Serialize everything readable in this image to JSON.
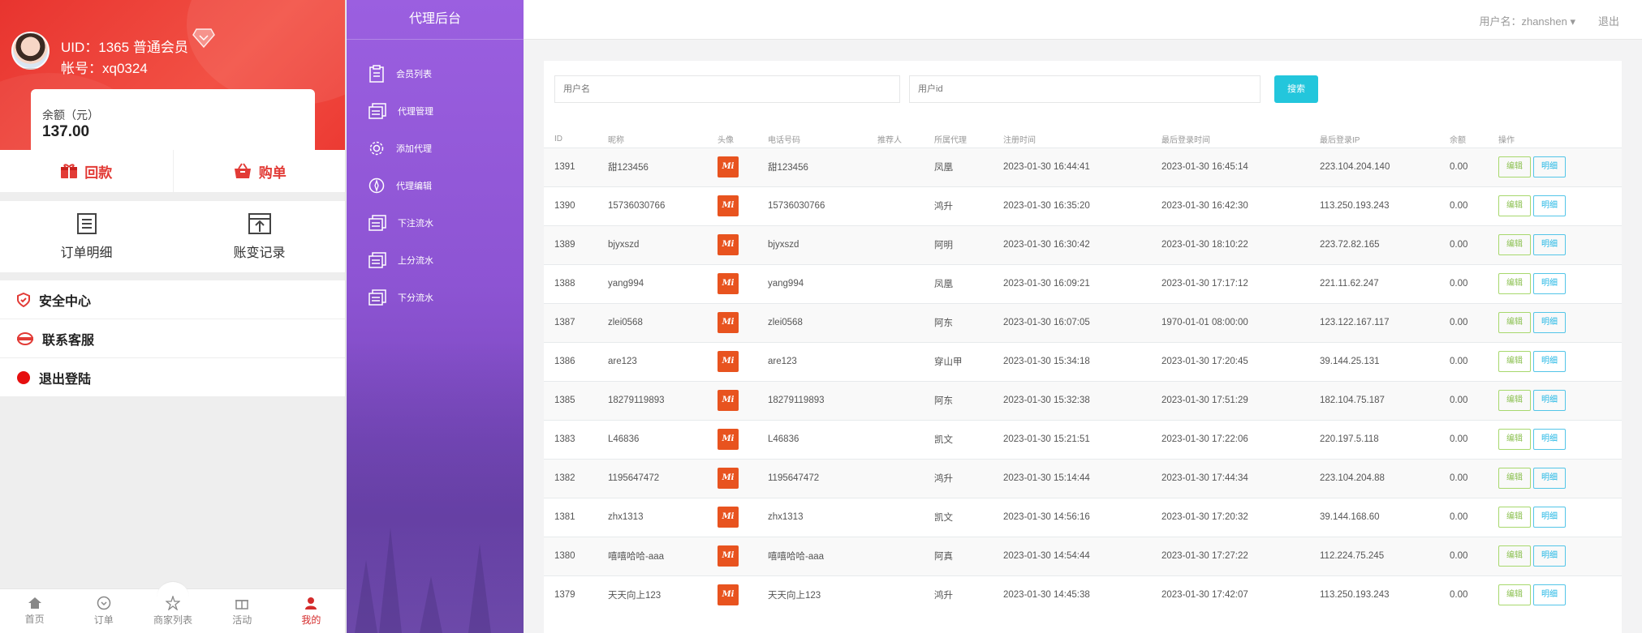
{
  "mobile": {
    "uid_line": "UID：1365 普通会员",
    "account_line": "帐号：xq0324",
    "balance_label": "余额（元）",
    "balance_value": "137.00",
    "actions": [
      {
        "label": "回款",
        "icon": "gift-icon"
      },
      {
        "label": "购单",
        "icon": "basket-icon"
      }
    ],
    "grid": [
      {
        "label": "订单明细",
        "icon": "document-icon"
      },
      {
        "label": "账变记录",
        "icon": "record-icon"
      }
    ],
    "menu": [
      {
        "label": "安全中心",
        "icon": "shield-icon"
      },
      {
        "label": "联系客服",
        "icon": "support-icon"
      },
      {
        "label": "退出登陆",
        "icon": "logout-dot-icon"
      }
    ],
    "tabbar": [
      {
        "label": "首页",
        "icon": "home-icon"
      },
      {
        "label": "订单",
        "icon": "order-icon"
      },
      {
        "label": "商家列表",
        "icon": "star-icon"
      },
      {
        "label": "活动",
        "icon": "gift-icon"
      },
      {
        "label": "我的",
        "icon": "person-icon"
      }
    ],
    "colors": {
      "brand": "#e8342f",
      "active_tab": "#d42b2b"
    }
  },
  "sidebar": {
    "title": "代理后台",
    "items": [
      {
        "label": "会员列表",
        "icon": "clipboard-icon"
      },
      {
        "label": "代理管理",
        "icon": "list-icon"
      },
      {
        "label": "添加代理",
        "icon": "gear-icon"
      },
      {
        "label": "代理编辑",
        "icon": "compass-icon"
      },
      {
        "label": "下注流水",
        "icon": "list-icon"
      },
      {
        "label": "上分流水",
        "icon": "list-icon"
      },
      {
        "label": "下分流水",
        "icon": "list-icon"
      }
    ],
    "colors": {
      "top": "#9b5fe0",
      "bottom": "#6a3fa8"
    }
  },
  "topbar": {
    "user_label": "用户名：zhanshen ▾",
    "logout_label": "退出"
  },
  "search": {
    "username_placeholder": "用户名",
    "userid_placeholder": "用户id",
    "button_label": "搜索"
  },
  "table": {
    "headers": [
      "ID",
      "昵称",
      "头像",
      "电话号码",
      "推荐人",
      "所属代理",
      "注册时间",
      "最后登录时间",
      "最后登录IP",
      "余额",
      "操作"
    ],
    "edit_label": "编辑",
    "detail_label": "明细",
    "avatar_text": "Mi",
    "rows": [
      {
        "id": "1391",
        "nickname": "甜123456",
        "phone": "甜123456",
        "referrer": "",
        "agent": "凤凰",
        "reg_time": "2023-01-30 16:44:41",
        "last_login": "2023-01-30 16:45:14",
        "ip": "223.104.204.140",
        "balance": "0.00"
      },
      {
        "id": "1390",
        "nickname": "15736030766",
        "phone": "15736030766",
        "referrer": "",
        "agent": "鸿升",
        "reg_time": "2023-01-30 16:35:20",
        "last_login": "2023-01-30 16:42:30",
        "ip": "113.250.193.243",
        "balance": "0.00"
      },
      {
        "id": "1389",
        "nickname": "bjyxszd",
        "phone": "bjyxszd",
        "referrer": "",
        "agent": "阿明",
        "reg_time": "2023-01-30 16:30:42",
        "last_login": "2023-01-30 18:10:22",
        "ip": "223.72.82.165",
        "balance": "0.00"
      },
      {
        "id": "1388",
        "nickname": "yang994",
        "phone": "yang994",
        "referrer": "",
        "agent": "凤凰",
        "reg_time": "2023-01-30 16:09:21",
        "last_login": "2023-01-30 17:17:12",
        "ip": "221.11.62.247",
        "balance": "0.00"
      },
      {
        "id": "1387",
        "nickname": "zlei0568",
        "phone": "zlei0568",
        "referrer": "",
        "agent": "阿东",
        "reg_time": "2023-01-30 16:07:05",
        "last_login": "1970-01-01 08:00:00",
        "ip": "123.122.167.117",
        "balance": "0.00"
      },
      {
        "id": "1386",
        "nickname": "are123",
        "phone": "are123",
        "referrer": "",
        "agent": "穿山甲",
        "reg_time": "2023-01-30 15:34:18",
        "last_login": "2023-01-30 17:20:45",
        "ip": "39.144.25.131",
        "balance": "0.00"
      },
      {
        "id": "1385",
        "nickname": "18279119893",
        "phone": "18279119893",
        "referrer": "",
        "agent": "阿东",
        "reg_time": "2023-01-30 15:32:38",
        "last_login": "2023-01-30 17:51:29",
        "ip": "182.104.75.187",
        "balance": "0.00"
      },
      {
        "id": "1383",
        "nickname": "L46836",
        "phone": "L46836",
        "referrer": "",
        "agent": "凯文",
        "reg_time": "2023-01-30 15:21:51",
        "last_login": "2023-01-30 17:22:06",
        "ip": "220.197.5.118",
        "balance": "0.00"
      },
      {
        "id": "1382",
        "nickname": "1195647472",
        "phone": "1195647472",
        "referrer": "",
        "agent": "鸿升",
        "reg_time": "2023-01-30 15:14:44",
        "last_login": "2023-01-30 17:44:34",
        "ip": "223.104.204.88",
        "balance": "0.00"
      },
      {
        "id": "1381",
        "nickname": "zhx1313",
        "phone": "zhx1313",
        "referrer": "",
        "agent": "凯文",
        "reg_time": "2023-01-30 14:56:16",
        "last_login": "2023-01-30 17:20:32",
        "ip": "39.144.168.60",
        "balance": "0.00"
      },
      {
        "id": "1380",
        "nickname": "嘻嘻哈哈-aaa",
        "phone": "嘻嘻哈哈-aaa",
        "referrer": "",
        "agent": "阿真",
        "reg_time": "2023-01-30 14:54:44",
        "last_login": "2023-01-30 17:27:22",
        "ip": "112.224.75.245",
        "balance": "0.00"
      },
      {
        "id": "1379",
        "nickname": "天天向上123",
        "phone": "天天向上123",
        "referrer": "",
        "agent": "鸿升",
        "reg_time": "2023-01-30 14:45:38",
        "last_login": "2023-01-30 17:42:07",
        "ip": "113.250.193.243",
        "balance": "0.00"
      }
    ],
    "colors": {
      "search_button": "#23c6dc",
      "edit_border": "#a7d86d",
      "detail_border": "#53c5e8",
      "avatar_bg": "#e8531f"
    }
  }
}
